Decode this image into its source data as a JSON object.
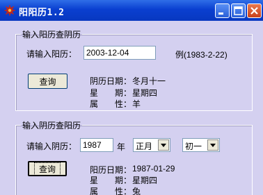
{
  "window": {
    "title": "阳阳历1.2"
  },
  "group1": {
    "legend": "输入阳历查阴历",
    "input_label": "请输入阳历：",
    "input_value": "2003-12-04",
    "example": "例(1983-2-22)",
    "query_button": "查询",
    "result": {
      "lunar_date_label": "阴历日期：",
      "lunar_date_value": "冬月十一",
      "weekday_label": "星　　期：",
      "weekday_value": "星期四",
      "zodiac_label": "属　　性：",
      "zodiac_value": "羊"
    }
  },
  "group2": {
    "legend": "输入阴历查阳历",
    "input_label": "请输入阴历：",
    "year_value": "1987",
    "year_unit": "年",
    "month_select": "正月",
    "day_select": "初一",
    "query_button": "查询",
    "result": {
      "solar_date_label": "阳历日期：",
      "solar_date_value": "1987-01-29",
      "weekday_label": "星　　期：",
      "weekday_value": "星期四",
      "zodiac_label": "属　　性：",
      "zodiac_value": "兔"
    }
  }
}
